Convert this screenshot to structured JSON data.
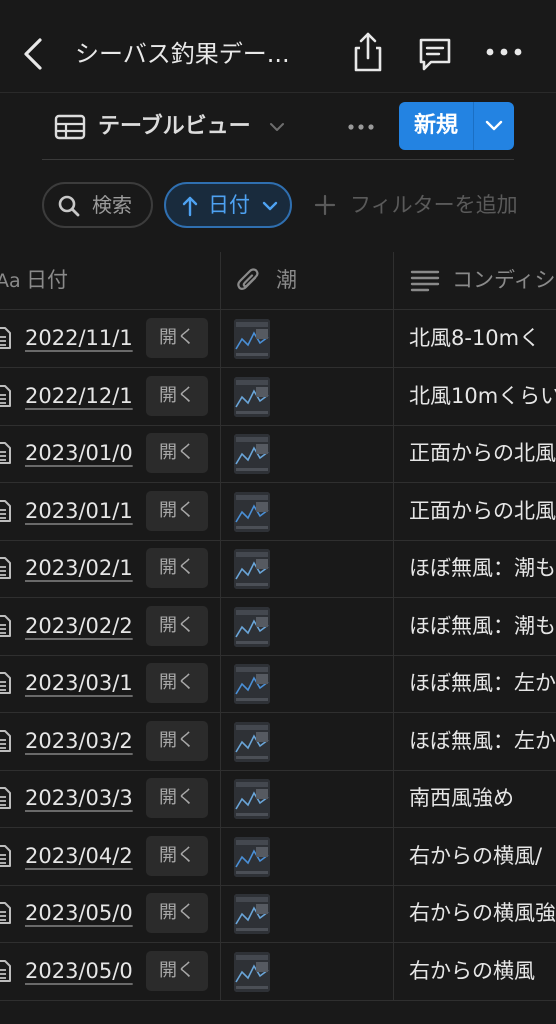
{
  "header": {
    "title": "シーバス釣果デー..."
  },
  "view": {
    "label": "テーブルビュー",
    "new_label": "新規"
  },
  "filters": {
    "search_label": "検索",
    "sort_label": "日付",
    "add_filter_label": "フィルターを追加"
  },
  "columns": {
    "title_type": "Aa",
    "date": "日付",
    "tide": "潮",
    "condition": "コンディション"
  },
  "rows": [
    {
      "date": "2022/11/1",
      "open": "開く",
      "condition": "北風8-10mく"
    },
    {
      "date": "2022/12/1",
      "open": "開く",
      "condition": "北風10mくらい"
    },
    {
      "date": "2023/01/0",
      "open": "開く",
      "condition": "正面からの北風"
    },
    {
      "date": "2023/01/1",
      "open": "開く",
      "condition": "正面からの北風"
    },
    {
      "date": "2023/02/1",
      "open": "開く",
      "condition": "ほぼ無風：潮も"
    },
    {
      "date": "2023/02/2",
      "open": "開く",
      "condition": "ほぼ無風：潮も"
    },
    {
      "date": "2023/03/1",
      "open": "開く",
      "condition": "ほぼ無風：左か"
    },
    {
      "date": "2023/03/2",
      "open": "開く",
      "condition": "ほぼ無風：左か"
    },
    {
      "date": "2023/03/3",
      "open": "開く",
      "condition": "南西風強め"
    },
    {
      "date": "2023/04/2",
      "open": "開く",
      "condition": "右からの横風/"
    },
    {
      "date": "2023/05/0",
      "open": "開く",
      "condition": "右からの横風強"
    },
    {
      "date": "2023/05/0",
      "open": "開く",
      "condition": "右からの横風"
    }
  ],
  "colors": {
    "background": "#191919",
    "accent": "#2383e2",
    "filter_active": "#4ea2f2"
  }
}
